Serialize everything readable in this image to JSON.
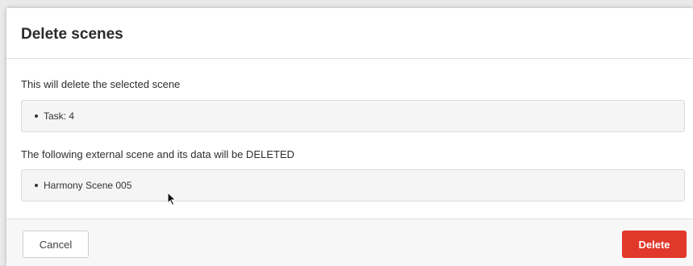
{
  "dialog": {
    "title": "Delete scenes",
    "selected_intro": "This will delete the selected scene",
    "selected_items": [
      "Task: 4"
    ],
    "external_intro": "The following external scene and its data will be DELETED",
    "external_items": [
      "Harmony Scene 005"
    ]
  },
  "footer": {
    "cancel_label": "Cancel",
    "delete_label": "Delete"
  },
  "colors": {
    "delete_button": "#e0382b",
    "box_background": "#f5f5f5"
  },
  "icons": {
    "cursor": "mouse-pointer-icon"
  }
}
